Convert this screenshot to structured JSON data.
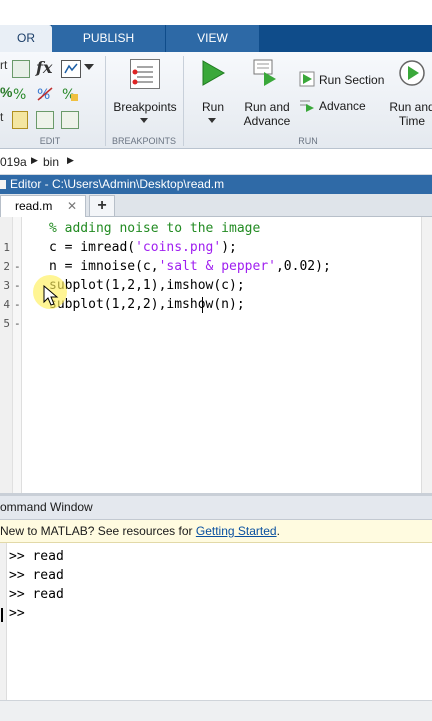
{
  "toolstrip": {
    "tabs": [
      {
        "label": "OR",
        "active": true
      },
      {
        "label": "PUBLISH",
        "active": false
      },
      {
        "label": "VIEW",
        "active": false
      }
    ],
    "groups": {
      "edit": "EDIT",
      "breakpoints": "BREAKPOINTS",
      "run": "RUN"
    },
    "buttons": {
      "breakpoints": "Breakpoints",
      "run": "Run",
      "run_and_advance_1": "Run and",
      "run_and_advance_2": "Advance",
      "run_section": "Run Section",
      "advance": "Advance",
      "run_and_time_1": "Run and",
      "run_and_time_2": "Time"
    },
    "edit_left_letters": [
      "rt",
      "%",
      "t"
    ]
  },
  "breadcrumb": {
    "items": [
      "019a",
      "bin"
    ]
  },
  "editor": {
    "title": "Editor - C:\\Users\\Admin\\Desktop\\read.m",
    "file_tab": "read.m",
    "add_tab": "+",
    "line_numbers": [
      "1",
      "2",
      "3",
      "4",
      "5"
    ],
    "lines": {
      "l1": "% adding noise to the image",
      "l2a": "c = imread(",
      "l2b": "'coins.png'",
      "l2c": ");",
      "l3a": "n = imnoise(c,",
      "l3b": "'salt & pepper'",
      "l3c": ",0.02);",
      "l4": "subplot(1,2,1),imshow(c);",
      "l5": "subplot(1,2,2),imshow(n);"
    }
  },
  "command_window": {
    "title": "ommand Window",
    "info_prefix": "New to MATLAB? See resources for ",
    "info_link": "Getting Started",
    "info_suffix": ".",
    "history": [
      ">> read",
      ">> read",
      ">> read"
    ],
    "prompt": ">>"
  },
  "colors": {
    "tab_bar": "#0f4c8a",
    "comment": "#228b22",
    "string": "#a020f0",
    "title_bar": "#2f6aa7"
  }
}
